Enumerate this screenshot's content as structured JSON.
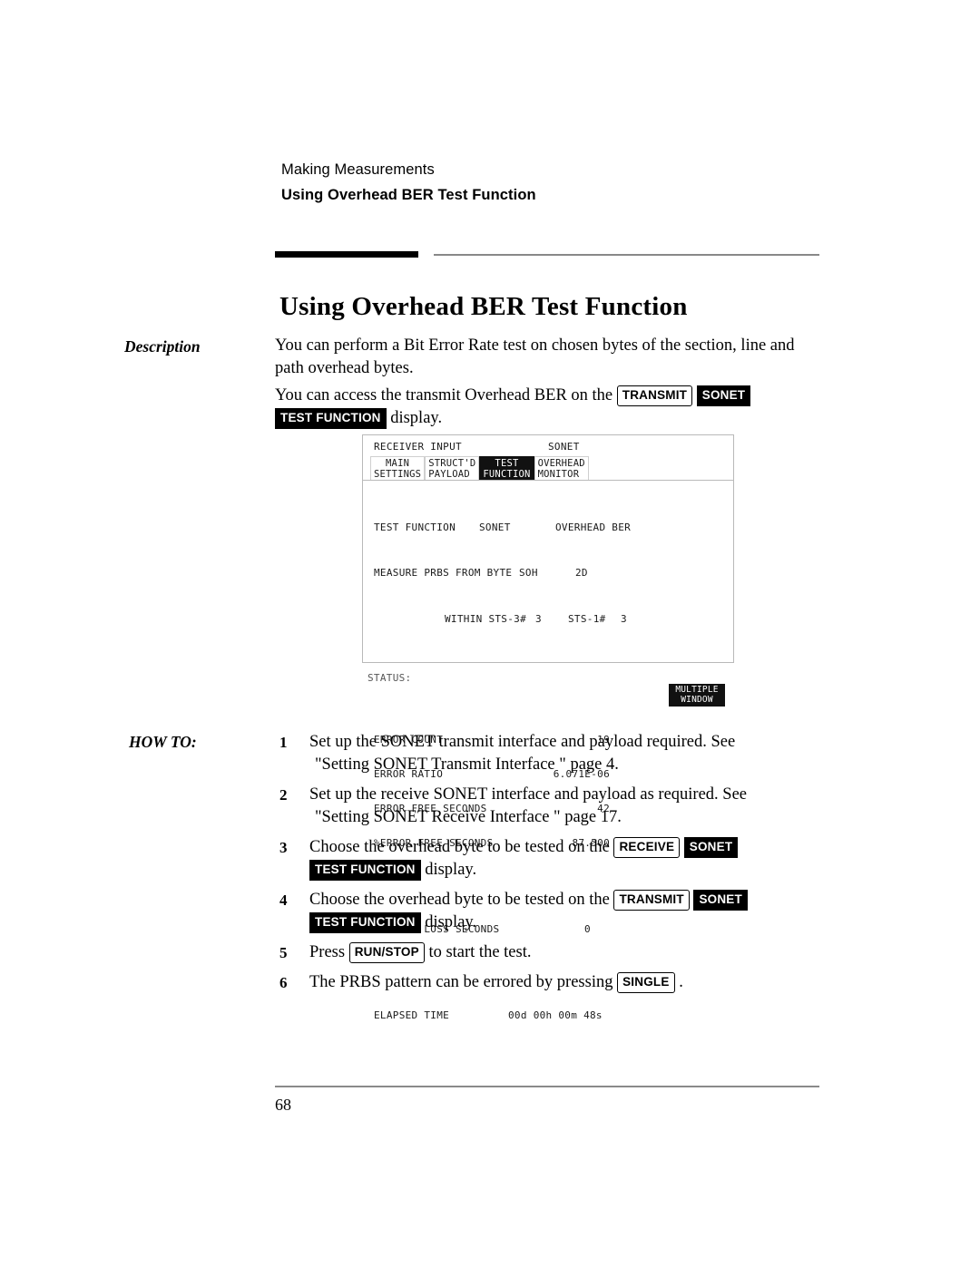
{
  "header": {
    "chapter": "Making Measurements",
    "section": "Using Overhead BER Test Function"
  },
  "title": "Using Overhead BER Test Function",
  "labels": {
    "description": "Description",
    "how_to": "HOW TO:"
  },
  "description": {
    "para1": "You can perform a Bit Error Rate test on chosen bytes of the section, line and path overhead bytes.",
    "para2_before": "You can access the transmit Overhead BER on the",
    "key_transmit": "TRANSMIT",
    "key_sonet": "SONET",
    "key_test_function": "TEST FUNCTION",
    "para2_after": "display."
  },
  "figure": {
    "crt": {
      "header_left": "RECEIVER INPUT",
      "header_right": "SONET",
      "tabs": [
        {
          "line1": " MAIN ",
          "line2": "SETTINGS",
          "active": false
        },
        {
          "line1": "STRUCT'D",
          "line2": "PAYLOAD ",
          "active": false
        },
        {
          "line1": "  TEST  ",
          "line2": "FUNCTION",
          "active": true
        },
        {
          "line1": "OVERHEAD",
          "line2": "MONITOR ",
          "active": false
        }
      ],
      "mode_line": {
        "label": "TEST FUNCTION",
        "middle": "SONET",
        "right": "OVERHEAD BER"
      },
      "measure_line": {
        "label": "MEASURE PRBS FROM BYTE",
        "layer": "SOH",
        "byte": "2D"
      },
      "within_line": {
        "label": "WITHIN STS-3#",
        "sts3": "3",
        "sts1_label": "STS-1#",
        "sts1": "3"
      },
      "results": [
        {
          "label": "ERROR COUNT",
          "value": "19"
        },
        {
          "label": "ERROR RATIO",
          "value": "6.071E-06"
        },
        {
          "label": "ERROR FREE SECONDS",
          "value": "42"
        },
        {
          "label": "%ERROR FREE SECONDS",
          "value": "87.500"
        }
      ],
      "pattern_loss": {
        "label": "PATTERN LOSS SECONDS",
        "value": "0"
      },
      "elapsed": {
        "label": "ELAPSED TIME",
        "value": "00d 00h 00m 48s"
      }
    },
    "status_label": "STATUS:",
    "multiple_window": {
      "line1": "MULTIPLE",
      "line2": " WINDOW "
    }
  },
  "steps": [
    {
      "num": "1",
      "text_1": "Set up the SONET transmit interface and payload required. See",
      "text_2": "\"Setting SONET Transmit Interface \"  page 4."
    },
    {
      "num": "2",
      "text_1": "Set up the receive SONET interface and payload as required. See",
      "text_2": "\"Setting SONET Receive Interface \"  page 17."
    },
    {
      "num": "3",
      "text_1": "Choose the overhead byte to be tested on the",
      "key_a": "RECEIVE",
      "key_b": "SONET",
      "key_c": "TEST FUNCTION",
      "text_2": "display."
    },
    {
      "num": "4",
      "text_1": "Choose the overhead byte to be tested on the",
      "key_a": "TRANSMIT",
      "key_b": "SONET",
      "key_c": "TEST FUNCTION",
      "text_2": "display."
    },
    {
      "num": "5",
      "text_1": "Press",
      "key_a": "RUN/STOP",
      "text_2": "to start the test."
    },
    {
      "num": "6",
      "text_1": "The PRBS pattern can be errored by pressing",
      "key_a": "SINGLE",
      "text_2": "."
    }
  ],
  "footer": {
    "page_number": "68"
  }
}
